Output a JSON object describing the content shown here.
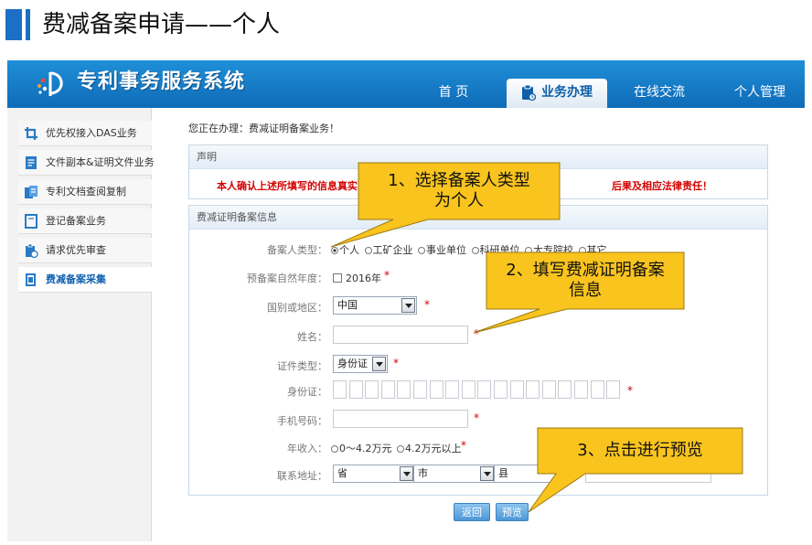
{
  "slide": {
    "title": "费减备案申请——个人"
  },
  "app": {
    "title": "专利事务服务系统",
    "nav": {
      "home": "首 页",
      "business": "业务办理",
      "online": "在线交流",
      "personal": "个人管理"
    }
  },
  "sidebar": {
    "items": [
      {
        "label": "优先权接入DAS业务",
        "icon": "crop-icon"
      },
      {
        "label": "文件副本&证明文件业务",
        "icon": "document-icon"
      },
      {
        "label": "专利文档查阅复制",
        "icon": "copy-document-icon"
      },
      {
        "label": "登记备案业务",
        "icon": "register-icon"
      },
      {
        "label": "请求优先审查",
        "icon": "priority-review-icon"
      },
      {
        "label": "费减备案采集",
        "icon": "fee-reduction-icon"
      }
    ]
  },
  "main": {
    "breadcrumb": "您正在办理：费减证明备案业务！",
    "notice": {
      "head": "声明",
      "text": "本人确认上述所填写的信息真实可靠",
      "tail": "后果及相应法律责任！"
    },
    "form": {
      "head": "费减证明备案信息",
      "applicant_type": {
        "label": "备案人类型：",
        "options": [
          "个人",
          "工矿企业",
          "事业单位",
          "科研单位",
          "大专院校",
          "其它"
        ],
        "selected": "个人"
      },
      "year": {
        "label": "预备案自然年度：",
        "value": "2016年"
      },
      "region": {
        "label": "国别或地区：",
        "value": "中国"
      },
      "name": {
        "label": "姓名：",
        "value": ""
      },
      "id_type": {
        "label": "证件类型：",
        "value": "身份证"
      },
      "id_number": {
        "label": "身份证：",
        "value": ""
      },
      "phone": {
        "label": "手机号码：",
        "value": ""
      },
      "income": {
        "label": "年收入：",
        "options": [
          "0～4.2万元",
          "4.2万元以上"
        ]
      },
      "address": {
        "label": "联系地址：",
        "province": "省",
        "city": "市",
        "county": "县"
      },
      "required_mark": "*"
    },
    "buttons": {
      "back": "返回",
      "preview": "预览"
    }
  },
  "callouts": [
    {
      "text": "1、选择备案人类型为个人"
    },
    {
      "text": "2、填写费减证明备案信息"
    },
    {
      "text": "3、点击进行预览"
    }
  ],
  "colors": {
    "header_blue": "#1b7fcf",
    "callout_fill": "#f9c41e",
    "required_red": "#d40000"
  }
}
